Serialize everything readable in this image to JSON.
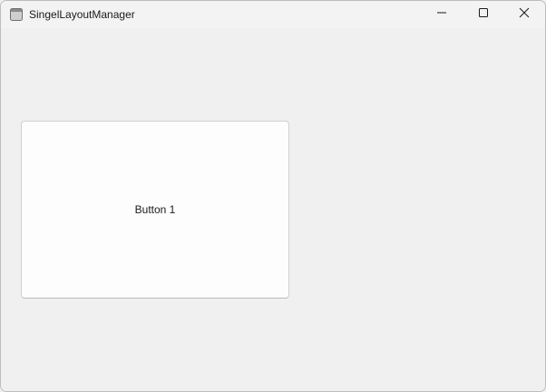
{
  "window": {
    "title": "SingelLayoutManager",
    "icons": {
      "app": "window-app-icon",
      "minimize": "minimize-icon",
      "maximize": "maximize-icon",
      "close": "close-icon"
    }
  },
  "content": {
    "button1_label": "Button 1"
  }
}
